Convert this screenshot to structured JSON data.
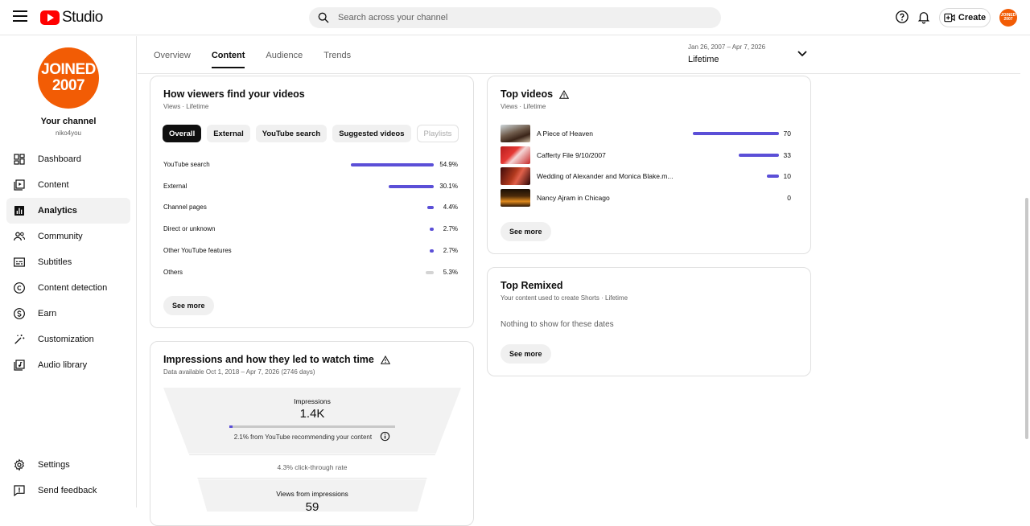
{
  "topbar": {
    "logo_text": "Studio",
    "search_placeholder": "Search across your channel",
    "create_label": "Create",
    "avatar_text": "JOINED 2007"
  },
  "sidebar": {
    "avatar_line1": "JOINED",
    "avatar_line2": "2007",
    "channel_name": "Your channel",
    "channel_handle": "niko4you",
    "items": [
      {
        "label": "Dashboard",
        "icon": "dashboard-icon"
      },
      {
        "label": "Content",
        "icon": "content-icon"
      },
      {
        "label": "Analytics",
        "icon": "analytics-icon",
        "active": true
      },
      {
        "label": "Community",
        "icon": "community-icon"
      },
      {
        "label": "Subtitles",
        "icon": "subtitles-icon"
      },
      {
        "label": "Content detection",
        "icon": "copyright-icon"
      },
      {
        "label": "Earn",
        "icon": "dollar-icon"
      },
      {
        "label": "Customization",
        "icon": "magic-wand-icon"
      },
      {
        "label": "Audio library",
        "icon": "audio-library-icon"
      }
    ],
    "bottom": [
      {
        "label": "Settings",
        "icon": "gear-icon"
      },
      {
        "label": "Send feedback",
        "icon": "feedback-icon"
      }
    ]
  },
  "tabs": [
    "Overview",
    "Content",
    "Audience",
    "Trends"
  ],
  "active_tab": "Content",
  "date_range": {
    "range": "Jan 26, 2007 – Apr 7, 2026",
    "period": "Lifetime"
  },
  "traffic": {
    "title": "How viewers find your videos",
    "subtitle": "Views · Lifetime",
    "chips": [
      "Overall",
      "External",
      "YouTube search",
      "Suggested videos",
      "Playlists"
    ],
    "sources": [
      {
        "label": "YouTube search",
        "value": "54.9%",
        "pct": 54.9
      },
      {
        "label": "External",
        "value": "30.1%",
        "pct": 30.1
      },
      {
        "label": "Channel pages",
        "value": "4.4%",
        "pct": 4.4
      },
      {
        "label": "Direct or unknown",
        "value": "2.7%",
        "pct": 2.7
      },
      {
        "label": "Other YouTube features",
        "value": "2.7%",
        "pct": 2.7
      },
      {
        "label": "Others",
        "value": "5.3%",
        "pct": 5.3
      }
    ],
    "see_more": "See more"
  },
  "top_videos": {
    "title": "Top videos",
    "subtitle": "Views · Lifetime",
    "videos": [
      {
        "title": "A Piece of Heaven",
        "views": "70",
        "count": 70
      },
      {
        "title": "Cafferty File 9/10/2007",
        "views": "33",
        "count": 33
      },
      {
        "title": "Wedding of Alexander and Monica Blake.m...",
        "views": "10",
        "count": 10
      },
      {
        "title": "Nancy Ajram in Chicago",
        "views": "0",
        "count": 0
      }
    ],
    "see_more": "See more"
  },
  "top_remixed": {
    "title": "Top Remixed",
    "subtitle": "Your content used to create Shorts · Lifetime",
    "empty": "Nothing to show for these dates",
    "see_more": "See more"
  },
  "impressions": {
    "title": "Impressions and how they led to watch time",
    "subtitle": "Data available Oct 1, 2018 – Apr 7, 2026 (2746 days)",
    "impressions_label": "Impressions",
    "impressions_value": "1.4K",
    "recommend_pct": 2.1,
    "recommend_note": "2.1% from YouTube recommending your content",
    "ctr": "4.3% click-through rate",
    "views_label": "Views from impressions",
    "views_value": "59"
  }
}
